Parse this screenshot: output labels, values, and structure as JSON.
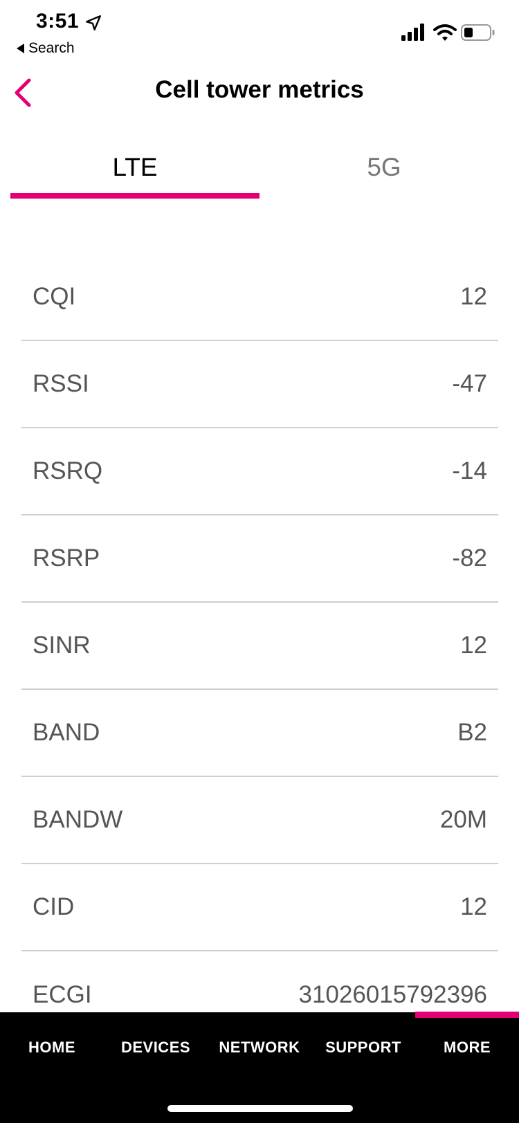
{
  "status_bar": {
    "time": "3:51",
    "back_app": "Search"
  },
  "header": {
    "title": "Cell tower metrics"
  },
  "tabs": [
    {
      "label": "LTE",
      "active": true
    },
    {
      "label": "5G",
      "active": false
    }
  ],
  "metrics": [
    {
      "label": "CQI",
      "value": "12"
    },
    {
      "label": "RSSI",
      "value": "-47"
    },
    {
      "label": "RSRQ",
      "value": "-14"
    },
    {
      "label": "RSRP",
      "value": "-82"
    },
    {
      "label": "SINR",
      "value": "12"
    },
    {
      "label": "BAND",
      "value": "B2"
    },
    {
      "label": "BANDW",
      "value": "20M"
    },
    {
      "label": "CID",
      "value": "12"
    },
    {
      "label": "ECGI",
      "value": "31026015792396"
    }
  ],
  "bottom_nav": {
    "items": [
      {
        "label": "HOME"
      },
      {
        "label": "DEVICES"
      },
      {
        "label": "NETWORK"
      },
      {
        "label": "SUPPORT"
      },
      {
        "label": "MORE"
      }
    ]
  },
  "colors": {
    "accent": "#e20074",
    "nav_bg": "#000000",
    "divider": "#cfcfcf",
    "metric_text": "#555555"
  },
  "icons": {
    "location": "location-arrow-icon",
    "signal": "cellular-signal-icon",
    "wifi": "wifi-icon",
    "battery": "battery-icon",
    "back": "chevron-left-icon"
  }
}
